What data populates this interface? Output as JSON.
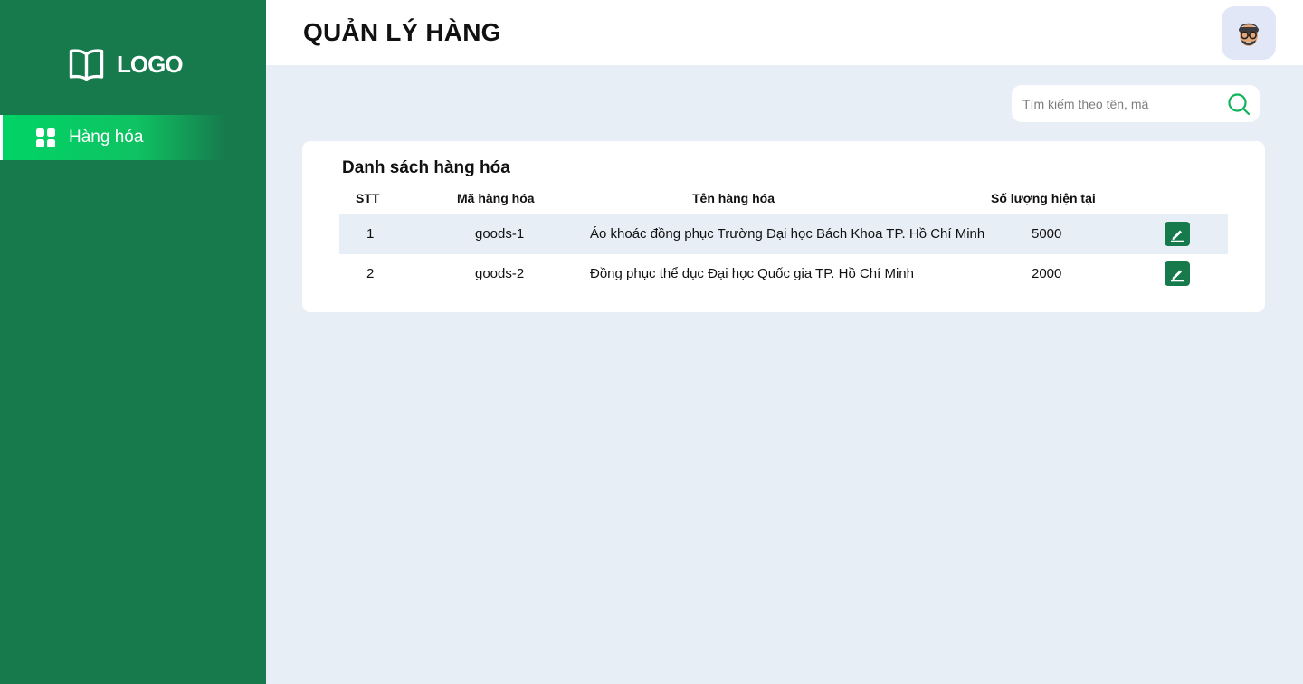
{
  "sidebar": {
    "logo_text": "LOGO",
    "items": [
      {
        "label": "Hàng hóa",
        "icon": "grid-icon",
        "active": true
      }
    ]
  },
  "header": {
    "title": "QUẢN LÝ HÀNG",
    "avatar": "user-avatar"
  },
  "search": {
    "placeholder": "Tìm kiếm theo tên, mã",
    "value": ""
  },
  "table": {
    "title": "Danh sách hàng hóa",
    "columns": [
      "STT",
      "Mã hàng hóa",
      "Tên hàng hóa",
      "Số lượng hiện tại"
    ],
    "rows": [
      {
        "stt": "1",
        "code": "goods-1",
        "name": "Áo khoác đồng phục Trường Đại học Bách Khoa TP. Hồ Chí Minh",
        "qty": "5000"
      },
      {
        "stt": "2",
        "code": "goods-2",
        "name": "Đồng phục thể dục Đại học Quốc gia TP. Hồ Chí Minh",
        "qty": "2000"
      }
    ]
  },
  "colors": {
    "sidebar_bg": "#167a4d",
    "active_item": "#00d466",
    "page_bg": "#e7eef6",
    "accent": "#167a4d"
  }
}
